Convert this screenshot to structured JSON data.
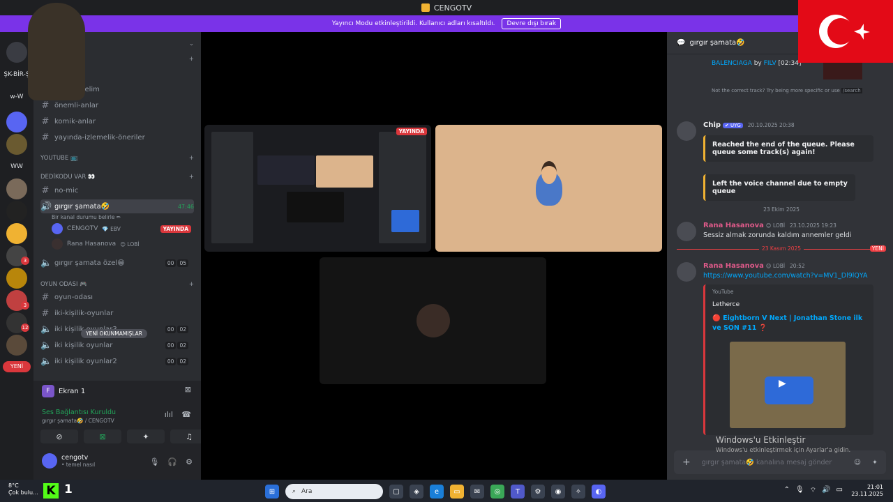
{
  "titlebar": {
    "title": "CENGOTV"
  },
  "banner": {
    "text": "Yayıncı Modu etkinleştirildi. Kullanıcı adları kısaltıldı.",
    "button": "Devre dışı bırak"
  },
  "rail": {
    "labels": [
      "ŞK-BİR-Ş",
      "w-W",
      "WW"
    ],
    "badges": [
      "3",
      "3",
      "3",
      "12"
    ],
    "new_label": "YENİ"
  },
  "channels": {
    "items": [
      {
        "label": "...-dinleyelim"
      },
      {
        "label": "önemli-anlar"
      },
      {
        "label": "komik-anlar"
      },
      {
        "label": "yayında-izlemelik-öneriler"
      }
    ],
    "cat_youtube": "YOUTUBE 📺",
    "cat_dedikodu": "DEDİKODU VAR 👀",
    "no_mic": "no-mic",
    "voice_active": {
      "label": "gırgır şamata🤣",
      "time": "47:46",
      "sub": "Bir kanal durumu belirle ✏"
    },
    "users": [
      {
        "name": "CENGOTV",
        "badge": "💎 EBV",
        "live": "YAYINDA"
      },
      {
        "name": "Rana Hasanova",
        "badge": "😊 LOBİ"
      }
    ],
    "voice_ozel": {
      "label": "gırgır şamata özel😁",
      "c1": "00",
      "c2": "05"
    },
    "cat_oyun": "OYUN ODASI 🎮",
    "oyun_items": [
      {
        "label": "oyun-odası"
      },
      {
        "label": "iki-kişilik-oyunlar"
      }
    ],
    "voice_list": [
      {
        "label": "iki kişilik oyunlar3",
        "c1": "00",
        "c2": "02"
      },
      {
        "label": "iki kişilik oyunlar",
        "c1": "00",
        "c2": "02"
      },
      {
        "label": "iki kişilik oyunlar2",
        "c1": "00",
        "c2": "02"
      }
    ],
    "unread_label": "YENİ OKUNMAMIŞLAR"
  },
  "voice_panel": {
    "title": "Ekran 1",
    "icon_letter": "F",
    "connected": "Ses Bağlantısı Kuruldu",
    "sub": "gırgır şamata🤣 / CENGOTV",
    "username": "cengotv",
    "status": "• temel nasıl"
  },
  "stage": {
    "live_badge": "YAYINDA"
  },
  "chat": {
    "channel": "gırgır şamata🤣",
    "track": {
      "song": "BALENCIAGA",
      "by": "by",
      "artist": "FILV",
      "time": "[02:34]",
      "hint": "Not the correct track? Try being more specific or use",
      "cmd": "/search"
    },
    "chip": {
      "name": "Chip",
      "tag": "✔ UYG",
      "time": "20.10.2025 20:38",
      "embed1": "Reached the end of the queue. Please queue some track(s) again!",
      "embed2": "Left the voice channel due to empty queue"
    },
    "div1": "23 Ekim 2025",
    "rana1": {
      "name": "Rana Hasanova",
      "role": "😊 LOBİ",
      "time": "23.10.2025 19:23",
      "text": "Sessiz almak zorunda kaldım annemler geldi"
    },
    "div2": "23 Kasım 2025",
    "new_tag": "YENİ",
    "rana2": {
      "name": "Rana Hasanova",
      "role": "😊 LOBİ",
      "time": "20:52",
      "link": "https://www.youtube.com/watch?v=MV1_Dl9lQYA"
    },
    "yt": {
      "source": "YouTube",
      "channel": "Letherce",
      "title": "🔴 Eightborn V Next | Jonathan Stone ilk ve SON #11 ❓"
    },
    "composer": "gırgır şamata🤣 kanalına mesaj gönder"
  },
  "activation": {
    "title": "Windows'u Etkinleştir",
    "sub": "Windows'u etkinleştirmek için Ayarlar'a gidin."
  },
  "taskbar": {
    "temp": "8°C",
    "weather": "Çok bulu...",
    "search": "Ara",
    "time": "21:01",
    "date": "23.11.2025",
    "k": "K",
    "one": "1"
  },
  "colors": {
    "accent": "#7a33e8",
    "live": "#da373c",
    "connected": "#23a55a",
    "link": "#00a8fc"
  }
}
